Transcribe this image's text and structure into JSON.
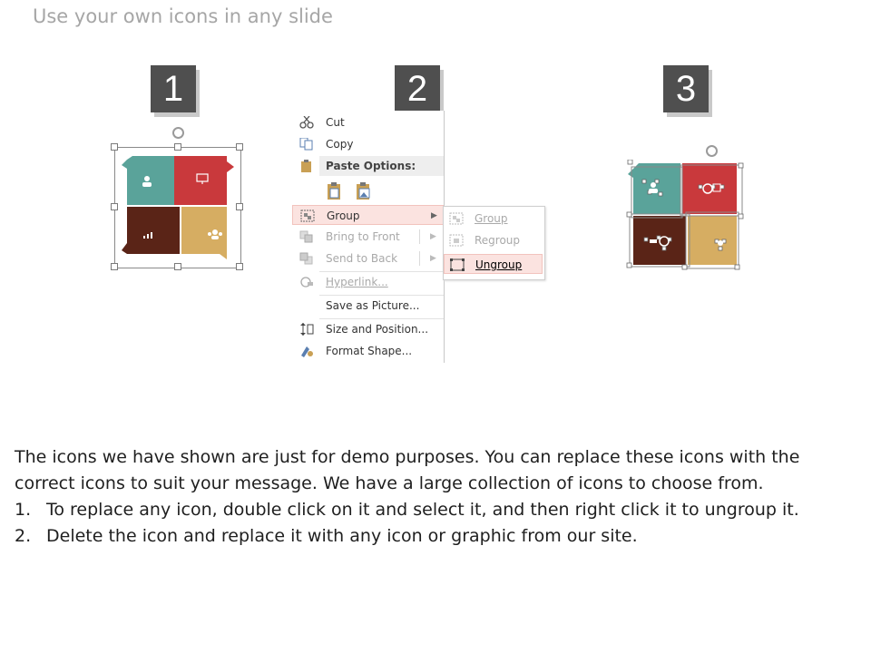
{
  "title": "Use your own icons in any slide",
  "steps": [
    "1",
    "2",
    "3"
  ],
  "colors": {
    "teal": "#5aa39a",
    "red": "#c9393c",
    "brown": "#5a2417",
    "gold": "#d6ad62",
    "badge": "#4f4f4f",
    "highlight": "#fbe3e0"
  },
  "context_menu": {
    "items": [
      {
        "label": "Cut",
        "icon": "scissors-icon",
        "enabled": true
      },
      {
        "label": "Copy",
        "icon": "copy-icon",
        "enabled": true
      },
      {
        "label": "Paste Options:",
        "icon": "clipboard-icon",
        "enabled": true
      },
      {
        "label": "Group",
        "icon": "group-icon",
        "enabled": true,
        "highlighted": true
      },
      {
        "label": "Bring to Front",
        "icon": "bring-to-front-icon",
        "enabled": false
      },
      {
        "label": "Send to Back",
        "icon": "send-to-back-icon",
        "enabled": false
      },
      {
        "label": "Hyperlink...",
        "icon": "link-icon",
        "enabled": false
      },
      {
        "label": "Save as Picture...",
        "icon": "",
        "enabled": true
      },
      {
        "label": "Size and Position...",
        "icon": "size-position-icon",
        "enabled": true
      },
      {
        "label": "Format Shape...",
        "icon": "format-shape-icon",
        "enabled": true
      }
    ],
    "submenu": [
      {
        "label": "Group",
        "enabled": false
      },
      {
        "label": "Regroup",
        "enabled": false
      },
      {
        "label": "Ungroup",
        "enabled": true,
        "highlighted": true
      }
    ]
  },
  "body": {
    "intro": "The icons we have shown are just for demo purposes. You can replace these icons with the correct icons to suit your message. We have a large collection of icons to choose from.",
    "list": [
      {
        "num": "1.",
        "text": "To replace any icon, double click on it and select it, and then right click it to ungroup it."
      },
      {
        "num": "2.",
        "text": "Delete the icon and replace it with any icon or graphic from our site."
      }
    ]
  }
}
